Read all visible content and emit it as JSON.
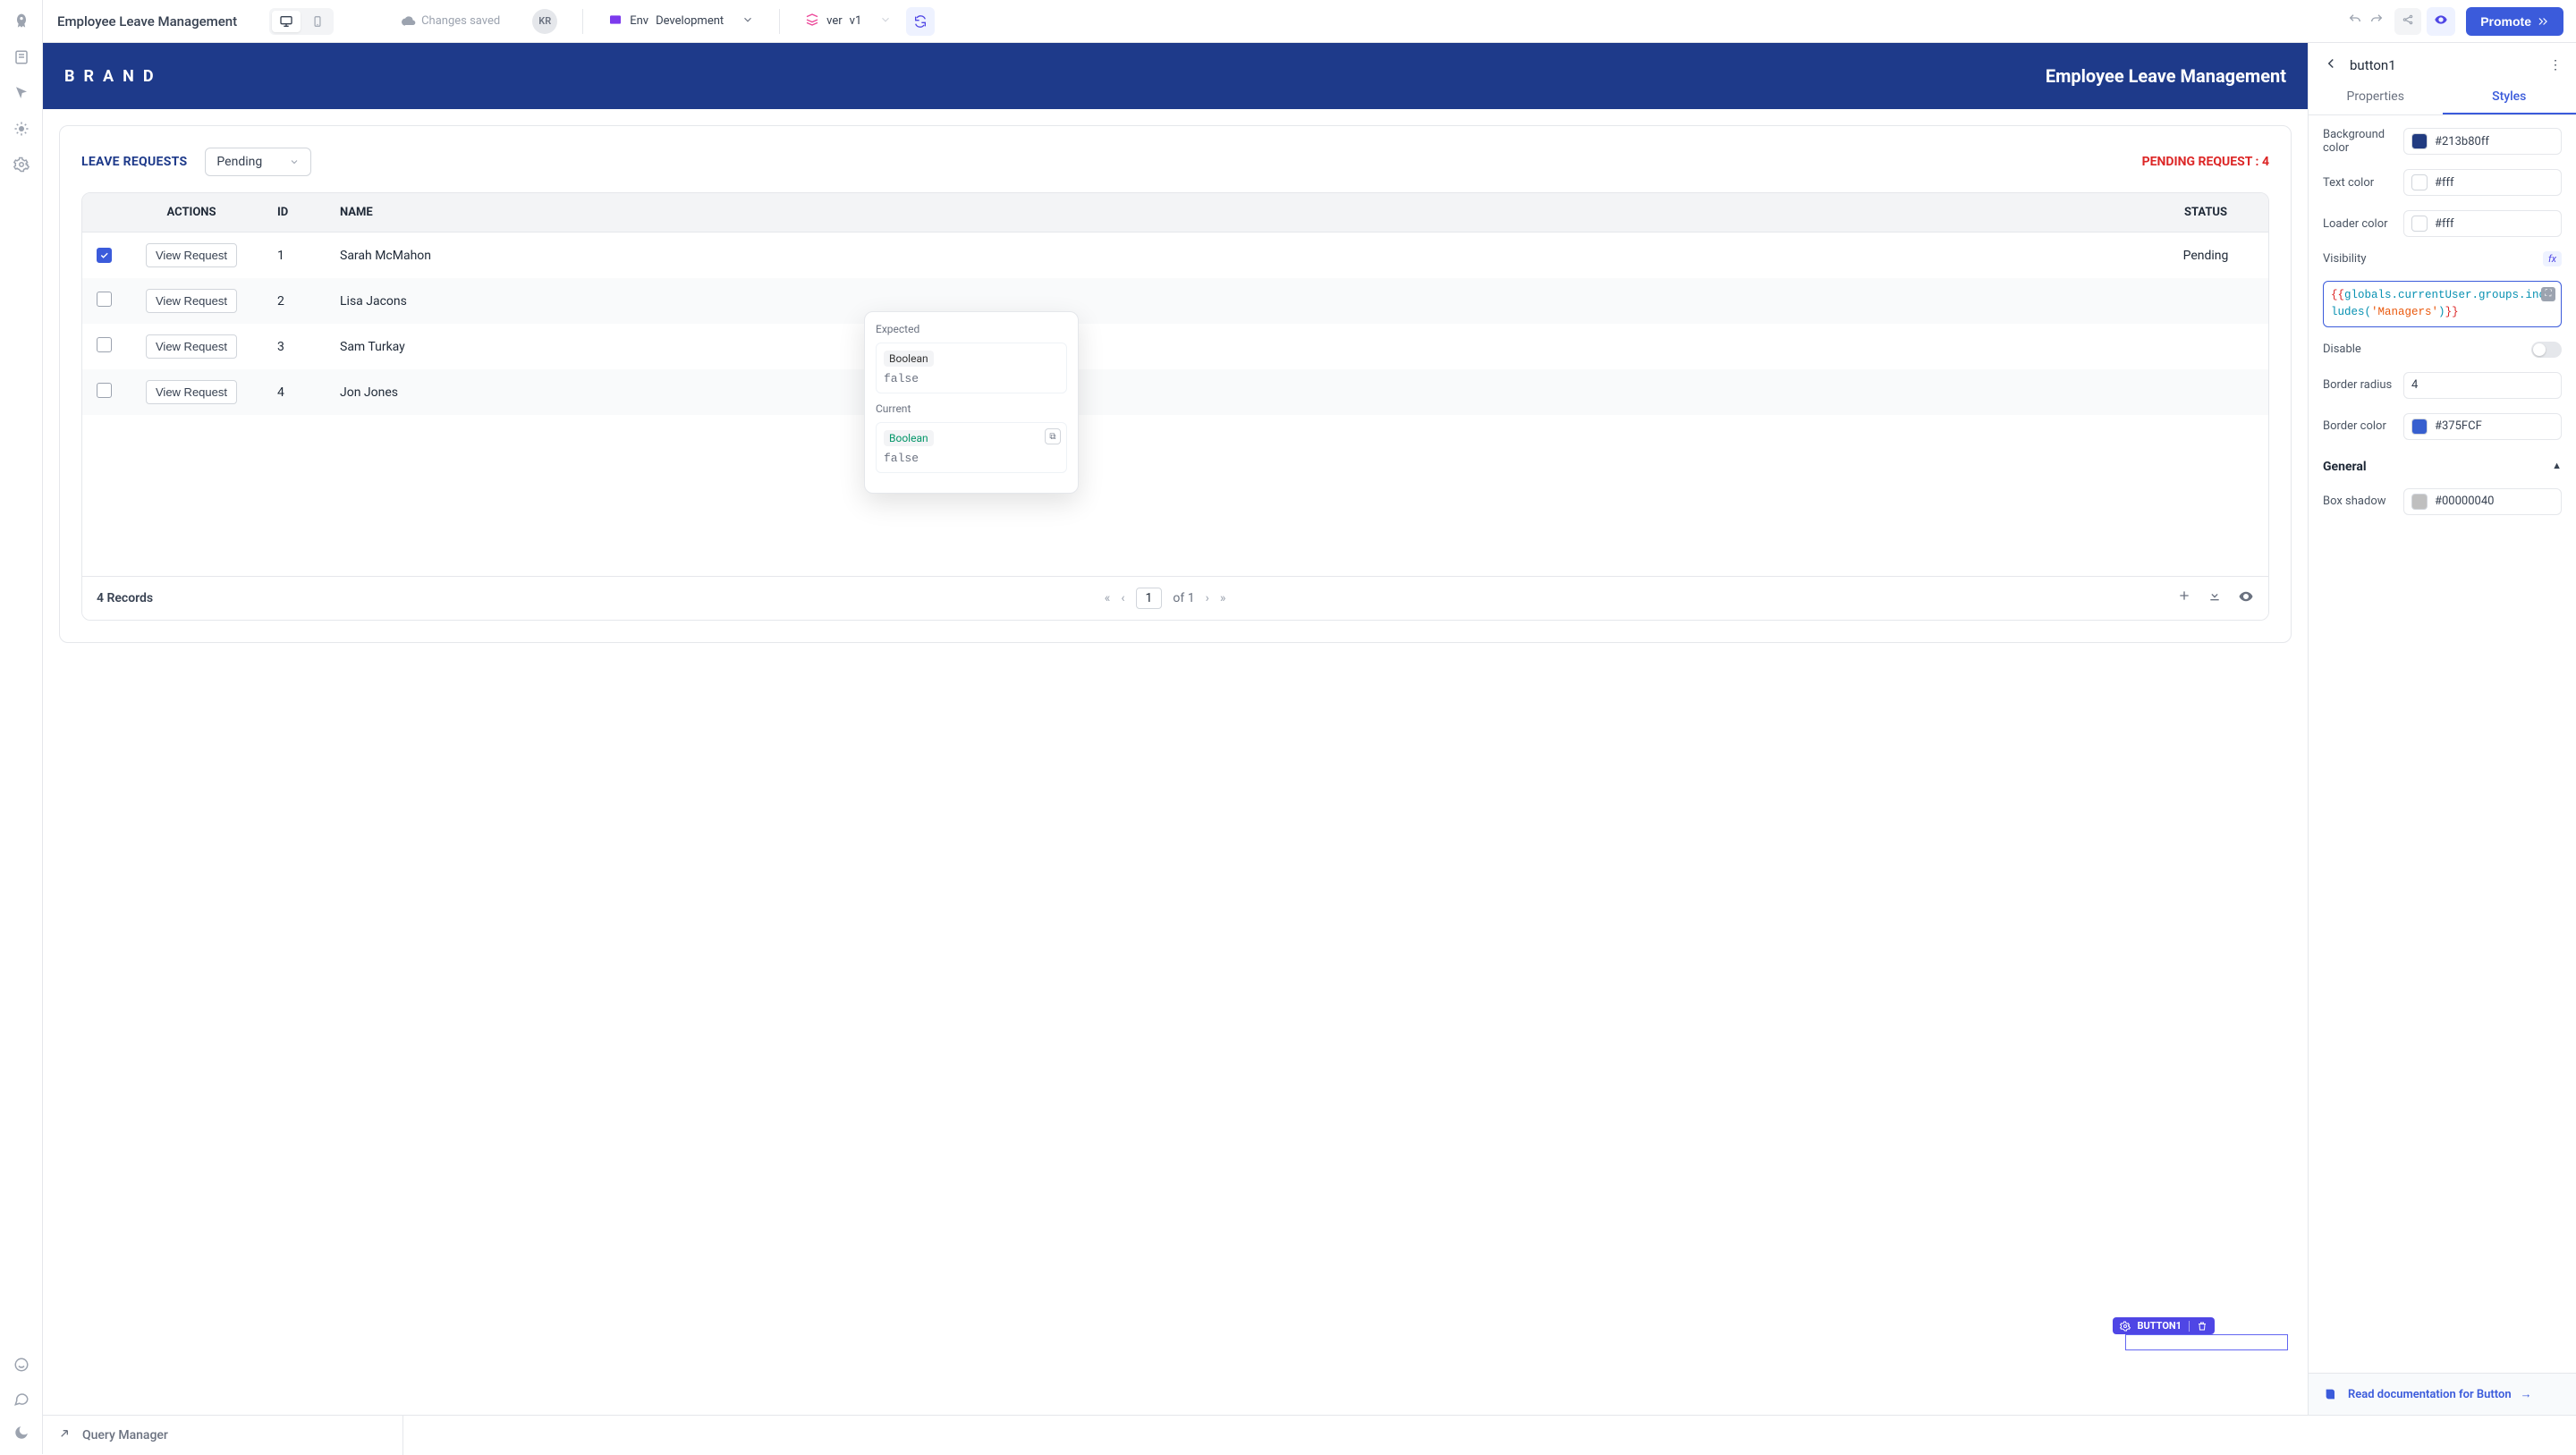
{
  "topbar": {
    "app_title": "Employee Leave Management",
    "saved_text": "Changes saved",
    "avatar_initials": "KR",
    "env_label": "Env",
    "env_value": "Development",
    "ver_label": "ver",
    "ver_value": "v1",
    "promote_label": "Promote"
  },
  "canvas": {
    "brand": "BRAND",
    "header_title": "Employee Leave Management",
    "card": {
      "title": "LEAVE REQUESTS",
      "filter_value": "Pending",
      "pending_label": "PENDING REQUEST : 4"
    },
    "table": {
      "columns": {
        "actions": "ACTIONS",
        "id": "ID",
        "name": "NAME",
        "status": "STATUS"
      },
      "view_btn": "View Request",
      "rows": [
        {
          "checked": true,
          "id": "1",
          "name": "Sarah McMahon",
          "status": "Pending"
        },
        {
          "checked": false,
          "id": "2",
          "name": "Lisa Jacons",
          "status": ""
        },
        {
          "checked": false,
          "id": "3",
          "name": "Sam Turkay",
          "status": ""
        },
        {
          "checked": false,
          "id": "4",
          "name": "Jon Jones",
          "status": ""
        }
      ],
      "footer": {
        "count": "4 Records",
        "page_num": "1",
        "page_of": "of 1"
      }
    },
    "selected_tag": "BUTTON1"
  },
  "popover": {
    "expected_label": "Expected",
    "current_label": "Current",
    "expected_type": "Boolean",
    "expected_value": "false",
    "current_type": "Boolean",
    "current_value": "false"
  },
  "inspector": {
    "component_name": "button1",
    "tabs": {
      "properties": "Properties",
      "styles": "Styles"
    },
    "bg_label": "Background color",
    "bg_value": "#213b80ff",
    "text_label": "Text color",
    "text_value": "#fff",
    "loader_label": "Loader color",
    "loader_value": "#fff",
    "visibility_label": "Visibility",
    "fx_label": "fx",
    "visibility_code_1": "{{",
    "visibility_code_2": "globals.currentUser.groups.inc",
    "visibility_code_3": "ludes",
    "visibility_code_4": "(",
    "visibility_code_5": "'Managers'",
    "visibility_code_6": ")",
    "visibility_code_7": "}}",
    "disable_label": "Disable",
    "radius_label": "Border radius",
    "radius_value": "4",
    "border_label": "Border color",
    "border_value": "#375FCF",
    "general_label": "General",
    "shadow_label": "Box shadow",
    "shadow_value": "#00000040",
    "doc_label": "Read documentation for Button"
  },
  "query_manager": {
    "label": "Query Manager"
  }
}
